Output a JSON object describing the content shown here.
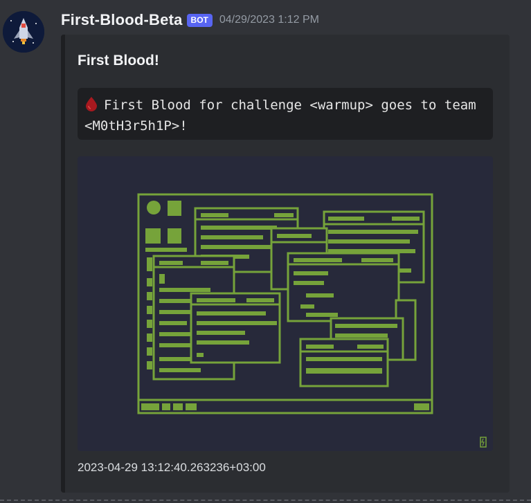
{
  "message": {
    "username": "First-Blood-Beta",
    "badge": "BOT",
    "timestamp": "04/29/2023 1:12 PM"
  },
  "embed": {
    "title": "First Blood!",
    "description": "First Blood for challenge <warmup> goes to team <M0tH3r5h1P>!",
    "footer": "2023-04-29 13:12:40.263236+03:00",
    "accent_color": "#1e1f22",
    "image_fg_color": "#76a33a",
    "image_bg_color": "#27293a"
  },
  "icons": {
    "avatar": "spaceship-avatar",
    "description_prefix": "blood-drop-icon",
    "image_corner": "battery-icon"
  }
}
